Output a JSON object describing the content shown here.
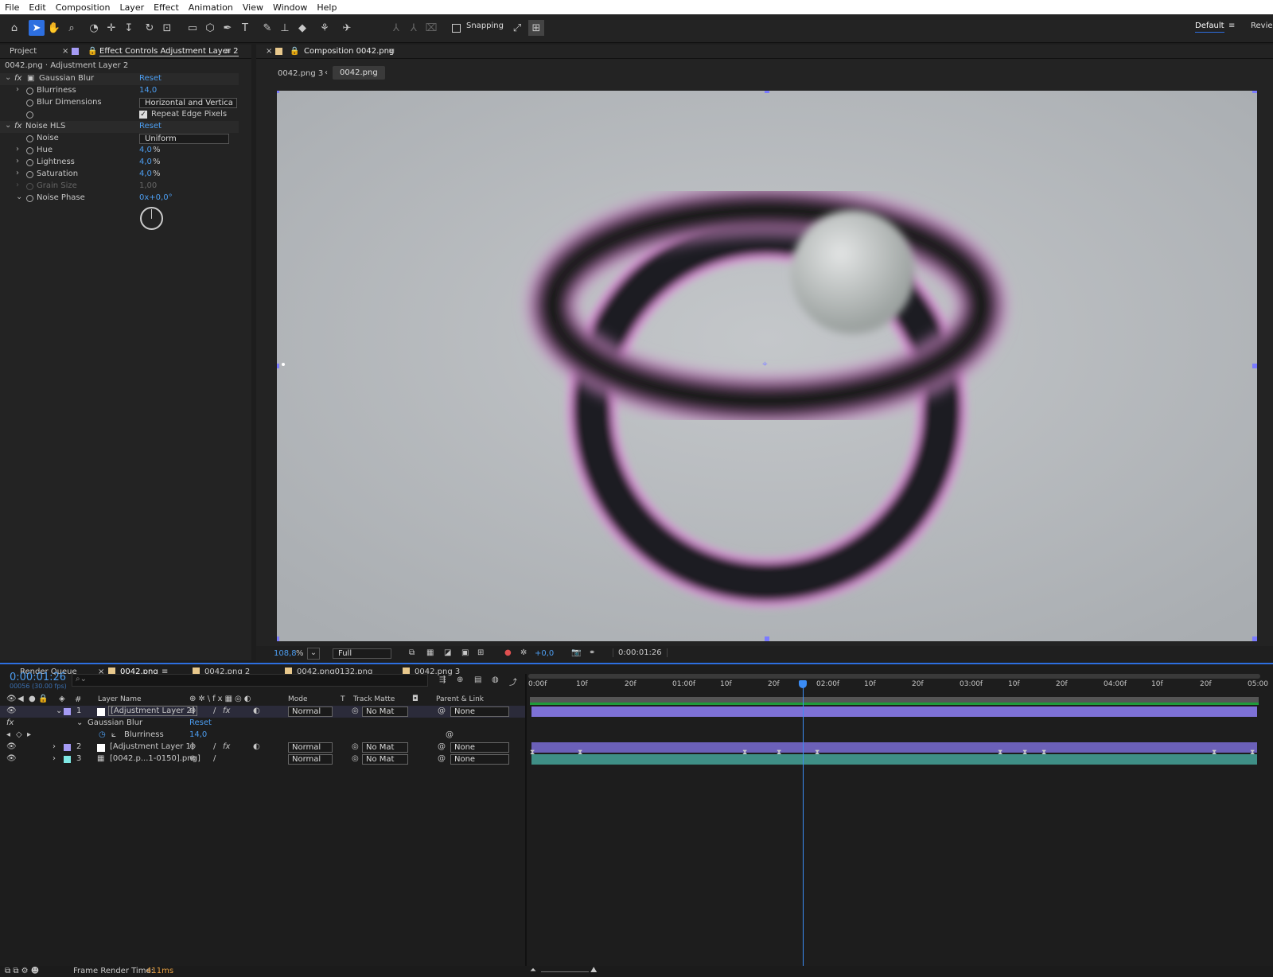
{
  "menu": [
    "File",
    "Edit",
    "Composition",
    "Layer",
    "Effect",
    "Animation",
    "View",
    "Window",
    "Help"
  ],
  "toolbar": {
    "snapping": "Snapping",
    "workspace": "Default",
    "review": "Review"
  },
  "left_panel": {
    "tab_project": "Project",
    "tab_effect": "Effect Controls Adjustment Layer 2",
    "subtitle": "0042.png · Adjustment Layer 2"
  },
  "effects": [
    {
      "name": "Gaussian Blur",
      "reset": "Reset"
    },
    {
      "name": "Noise HLS",
      "reset": "Reset"
    }
  ],
  "params": {
    "blurriness": {
      "label": "Blurriness",
      "value": "14,0"
    },
    "blur_dimensions": {
      "label": "Blur Dimensions",
      "value": "Horizontal and Vertica"
    },
    "repeat_edge": "Repeat Edge Pixels",
    "noise": {
      "label": "Noise",
      "value": "Uniform"
    },
    "hue": {
      "label": "Hue",
      "value": "4,0",
      "unit": "%"
    },
    "lightness": {
      "label": "Lightness",
      "value": "4,0",
      "unit": "%"
    },
    "saturation": {
      "label": "Saturation",
      "value": "4,0",
      "unit": "%"
    },
    "grain_size": {
      "label": "Grain Size",
      "value": "1,00"
    },
    "noise_phase": {
      "label": "Noise Phase",
      "value": "0x+0,0°"
    }
  },
  "comp": {
    "tab": "Composition 0042.png",
    "crumb1": "0042.png 3",
    "crumb2": "0042.png"
  },
  "viewer_bar": {
    "zoom": "108,8",
    "zoom_unit": "%",
    "resolution": "Full",
    "exposure": "+0,0",
    "timecode": "0:00:01:26"
  },
  "timeline": {
    "tabs": [
      "Render Queue",
      "0042.png",
      "0042.png 2",
      "0042.png0132.png",
      "0042.png 3"
    ],
    "timecode": "0:00:01:26",
    "fps": "00056 (30.00 fps)",
    "headers": {
      "layer_name": "Layer Name",
      "mode": "Mode",
      "t": "T",
      "track_matte": "Track Matte",
      "parent": "Parent & Link",
      "num": "#"
    },
    "ruler": [
      "0:00f",
      "10f",
      "20f",
      "01:00f",
      "10f",
      "20f",
      "02:00f",
      "10f",
      "20f",
      "03:00f",
      "10f",
      "20f",
      "04:00f",
      "10f",
      "20f",
      "05:00"
    ],
    "layers": [
      {
        "num": "1",
        "name": "[Adjustment Layer 2]",
        "mode": "Normal",
        "matte": "No Mat",
        "parent": "None",
        "color": "#a59bf5"
      },
      {
        "num": "2",
        "name": "[Adjustment Layer 1]",
        "mode": "Normal",
        "matte": "No Mat",
        "parent": "None",
        "color": "#a59bf5"
      },
      {
        "num": "3",
        "name": "[0042.p...1-0150].png]",
        "mode": "Normal",
        "matte": "No Mat",
        "parent": "None",
        "color": "#7fe8e4"
      }
    ],
    "sub_effect": "Gaussian Blur",
    "sub_reset": "Reset",
    "sub_param": "Blurriness",
    "sub_value": "14,0"
  },
  "status": {
    "label": "Frame Render Time:",
    "value": "411ms"
  },
  "colors": {
    "accent": "#2d6fe0",
    "value_blue": "#4c9df0",
    "layer_bar": "#6b60b8",
    "footage_bar": "#3f8f86",
    "playhead": "#3b8cf5"
  }
}
